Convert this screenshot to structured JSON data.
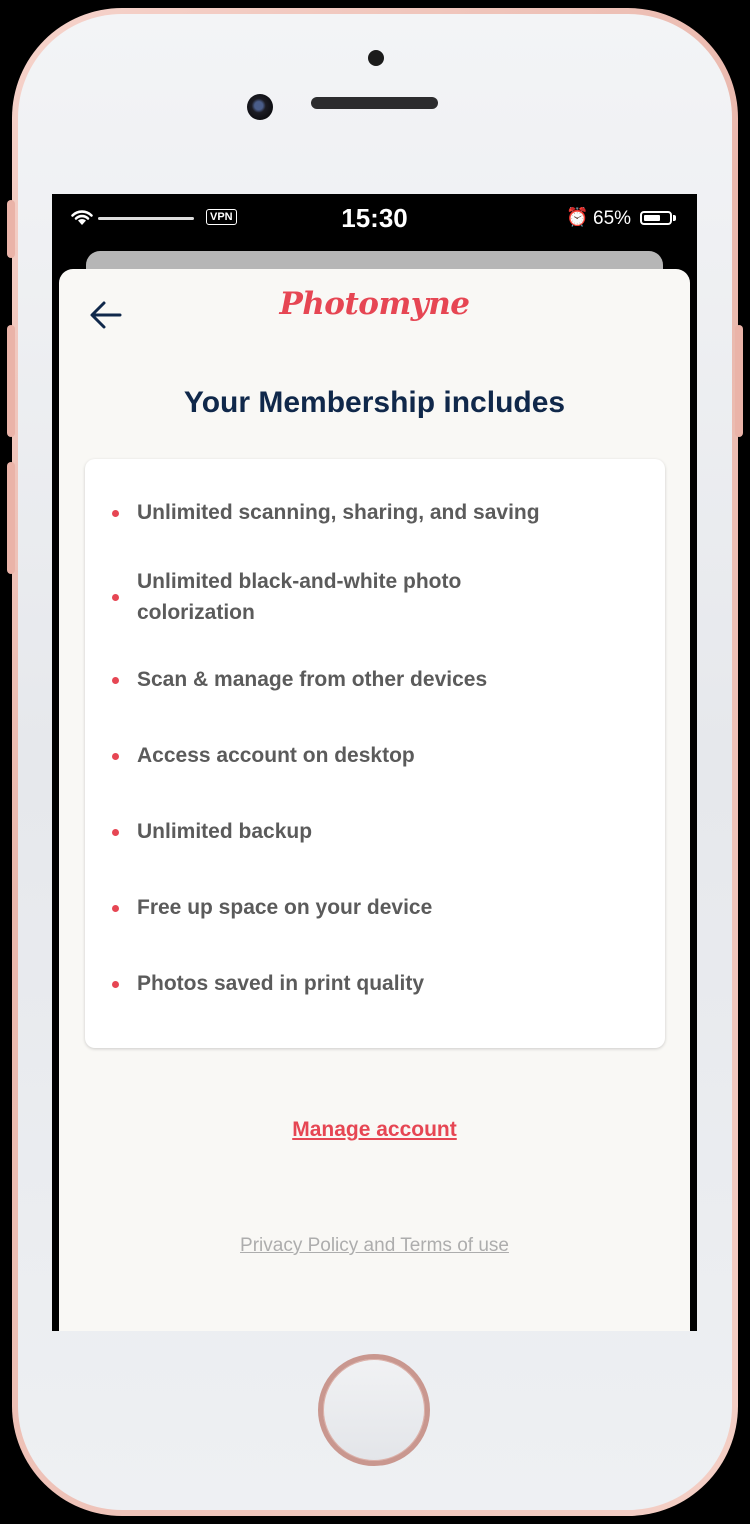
{
  "status_bar": {
    "time": "15:30",
    "vpn_label": "VPN",
    "battery_percent": "65%",
    "battery_level": 0.65,
    "icons": [
      "wifi-icon",
      "alarm-icon",
      "battery-icon"
    ]
  },
  "header": {
    "logo": "Photomyne",
    "back_icon": "arrow-left-icon"
  },
  "main": {
    "title": "Your Membership includes",
    "features": [
      "Unlimited scanning, sharing, and saving",
      "Unlimited black-and-white photo colorization",
      "Scan & manage from other devices",
      "Access account on desktop",
      "Unlimited backup",
      "Free up space on your device",
      "Photos saved in print quality"
    ]
  },
  "links": {
    "manage_account": "Manage account",
    "privacy_terms": "Privacy Policy and Terms of use"
  },
  "colors": {
    "accent": "#e64653",
    "heading": "#10284a",
    "body_text": "#5b5b5b",
    "muted": "#adadad"
  }
}
